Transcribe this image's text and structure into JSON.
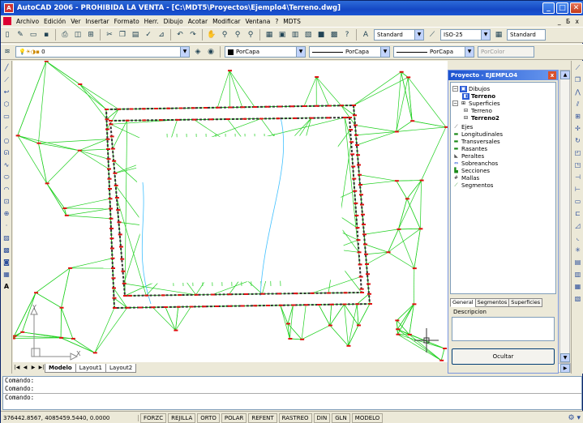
{
  "window": {
    "title": "AutoCAD 2006 - PROHIBIDA LA VENTA - [C:\\MDT5\\Proyectos\\Ejemplo4\\Terreno.dwg]",
    "app_icon": "A"
  },
  "menu": {
    "items": [
      "Archivo",
      "Edición",
      "Ver",
      "Insertar",
      "Formato",
      "Herr.",
      "Dibujo",
      "Acotar",
      "Modificar",
      "Ventana",
      "?",
      "MDTS"
    ],
    "mdi_controls": "_ Б x"
  },
  "toolbar_standard": {
    "text_style": "Standard",
    "dim_style": "ISO-25",
    "table_style": "Standard"
  },
  "toolbar_layers": {
    "layer": "0",
    "color": "PorCapa",
    "linetype": "PorCapa",
    "lineweight": "PorCapa",
    "plotstyle": "PorColor"
  },
  "layout_tabs": [
    "Modelo",
    "Layout1",
    "Layout2"
  ],
  "ucs": {
    "y": "Y",
    "x": "X"
  },
  "panel": {
    "title": "Proyecto - EJEMPLO4",
    "close": "x",
    "tree": [
      {
        "label": "Dibujos",
        "icon": "folder-icon"
      },
      {
        "label": "Terreno",
        "icon": "drawing-icon",
        "bold": true
      },
      {
        "label": "Superficies",
        "icon": "surfaces-icon"
      },
      {
        "label": "Terreno",
        "icon": "surface-icon"
      },
      {
        "label": "Terreno2",
        "icon": "surface-icon",
        "bold": true
      },
      {
        "label": "Ejes",
        "icon": "axis-icon"
      },
      {
        "label": "Longitudinales",
        "icon": "profile-icon"
      },
      {
        "label": "Transversales",
        "icon": "cross-section-icon"
      },
      {
        "label": "Rasantes",
        "icon": "grade-icon"
      },
      {
        "label": "Peraltes",
        "icon": "superelevation-icon"
      },
      {
        "label": "Sobreanchos",
        "icon": "widening-icon"
      },
      {
        "label": "Secciones",
        "icon": "sections-icon"
      },
      {
        "label": "Mallas",
        "icon": "mesh-icon"
      },
      {
        "label": "Segmentos",
        "icon": "segments-icon"
      }
    ],
    "tabs": [
      "General",
      "Segmentos",
      "Superficies"
    ],
    "description_label": "Descripcion",
    "hide_button": "Ocultar"
  },
  "command": {
    "line1": "Comando:",
    "line2": "Comando:",
    "prompt": "Comando:"
  },
  "status": {
    "coords": "376442.8567, 4085459.5440, 0.0000",
    "buttons": [
      "FORZC",
      "REJILLA",
      "ORTO",
      "POLAR",
      "REFENT",
      "RASTREO",
      "DIN",
      "GLN",
      "MODELO"
    ]
  },
  "colors": {
    "triangulation": "#1fd01f",
    "points": "#e01010",
    "contour": "#303030",
    "drainage": "#40c0ff"
  }
}
